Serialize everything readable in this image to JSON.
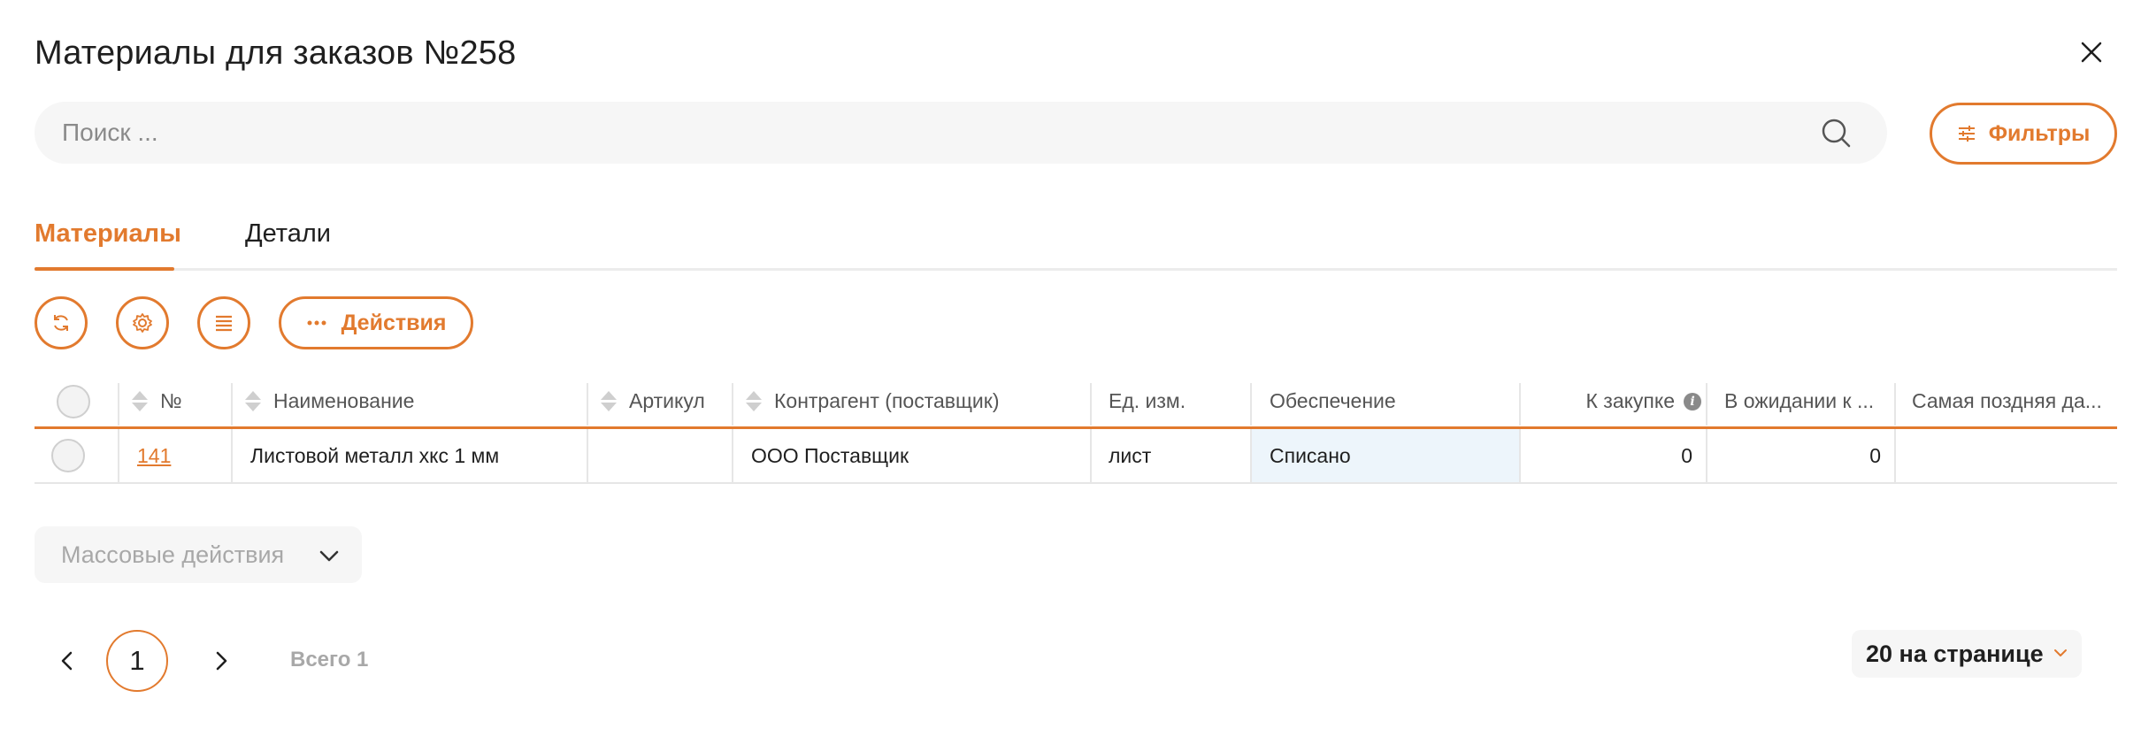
{
  "dialog": {
    "title": "Материалы для заказов №258"
  },
  "search": {
    "placeholder": "Поиск ...",
    "value": ""
  },
  "filters_button": {
    "label": "Фильтры"
  },
  "tabs": [
    {
      "label": "Материалы",
      "active": true
    },
    {
      "label": "Детали",
      "active": false
    }
  ],
  "toolbar": {
    "actions_label": "Действия"
  },
  "table": {
    "columns": [
      "№",
      "Наименование",
      "Артикул",
      "Контрагент (поставщик)",
      "Ед. изм.",
      "Обеспечение",
      "К закупке",
      "В ожидании к ...",
      "Самая поздняя да..."
    ],
    "rows": [
      {
        "number": "141",
        "name": "Листовой металл хкс 1 мм",
        "article": "",
        "supplier": "ООО Поставщик",
        "unit": "лист",
        "supply": "Списано",
        "to_purchase": "0",
        "waiting": "0",
        "latest_date": ""
      }
    ]
  },
  "mass_actions": {
    "label": "Массовые действия"
  },
  "pagination": {
    "current_page": "1",
    "total_label": "Всего 1"
  },
  "per_page": {
    "label": "20 на странице"
  },
  "colors": {
    "accent": "#e27a2e",
    "muted_text": "#a8a8a8",
    "supply_highlight": "#edf5fb"
  }
}
